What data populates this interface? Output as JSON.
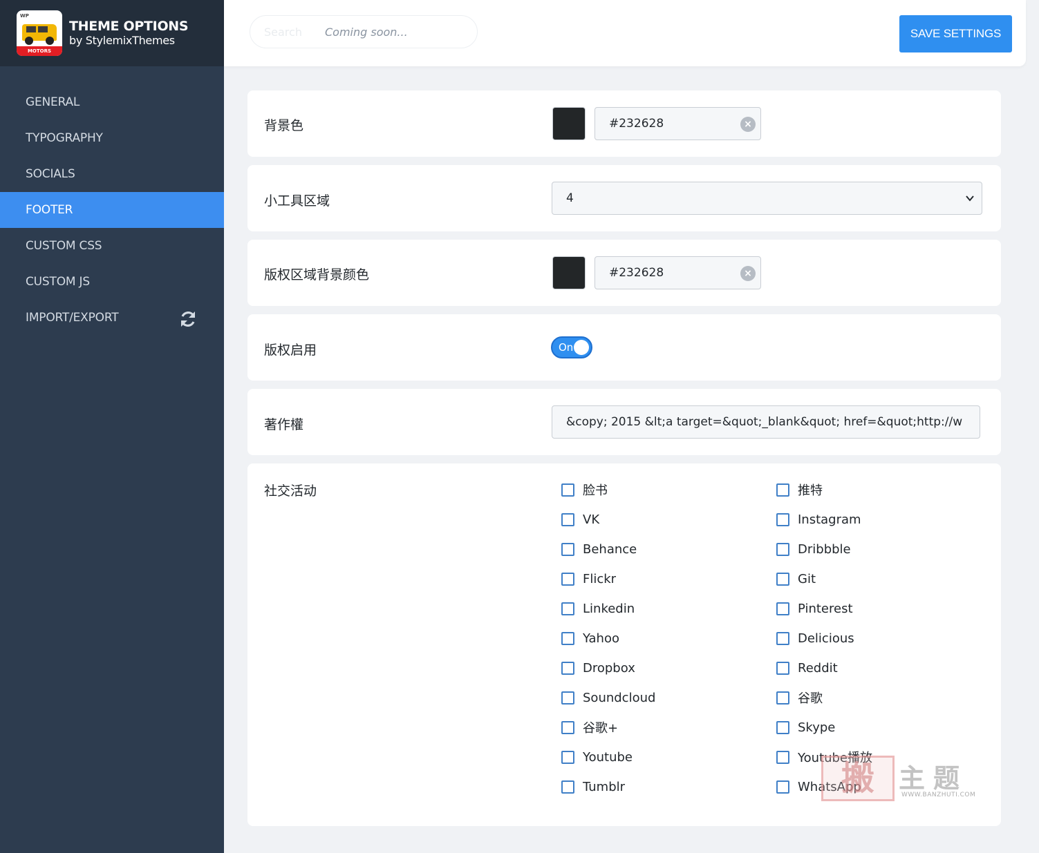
{
  "brand": {
    "title": "THEME OPTIONS",
    "subtitle": "by StylemixThemes",
    "logo_top": "WP",
    "logo_ribbon": "MOTORS"
  },
  "nav": {
    "items": [
      {
        "label": "GENERAL"
      },
      {
        "label": "TYPOGRAPHY"
      },
      {
        "label": "SOCIALS"
      },
      {
        "label": "FOOTER"
      },
      {
        "label": "CUSTOM CSS"
      },
      {
        "label": "CUSTOM JS"
      },
      {
        "label": "IMPORT/EXPORT",
        "icon": "refresh-icon"
      }
    ],
    "active": "FOOTER"
  },
  "header": {
    "search_placeholder": "Search",
    "search_note": "Coming soon...",
    "save_label": "SAVE SETTINGS"
  },
  "fields": {
    "bg_color": {
      "label": "背景色",
      "value": "#232628",
      "swatch": "#232628"
    },
    "widget_area": {
      "label": "小工具区域",
      "value": "4"
    },
    "copyright_bg": {
      "label": "版权区域背景颜色",
      "value": "#232628",
      "swatch": "#232628"
    },
    "copyright_enable": {
      "label": "版权启用",
      "toggle_text": "On",
      "enabled": true
    },
    "copyright_text": {
      "label": "著作權",
      "value": "&copy; 2015 &lt;a target=&quot;_blank&quot; href=&quot;http://w"
    },
    "socials": {
      "label": "社交活动",
      "options": [
        {
          "label": "脸书",
          "checked": false
        },
        {
          "label": "推特",
          "checked": false
        },
        {
          "label": "VK",
          "checked": false
        },
        {
          "label": "Instagram",
          "checked": false
        },
        {
          "label": "Behance",
          "checked": false
        },
        {
          "label": "Dribbble",
          "checked": false
        },
        {
          "label": "Flickr",
          "checked": false
        },
        {
          "label": "Git",
          "checked": false
        },
        {
          "label": "Linkedin",
          "checked": false
        },
        {
          "label": "Pinterest",
          "checked": false
        },
        {
          "label": "Yahoo",
          "checked": false
        },
        {
          "label": "Delicious",
          "checked": false
        },
        {
          "label": "Dropbox",
          "checked": false
        },
        {
          "label": "Reddit",
          "checked": false
        },
        {
          "label": "Soundcloud",
          "checked": false
        },
        {
          "label": "谷歌",
          "checked": false
        },
        {
          "label": "谷歌+",
          "checked": false
        },
        {
          "label": "Skype",
          "checked": false
        },
        {
          "label": "Youtube",
          "checked": false
        },
        {
          "label": "Youtube播放",
          "checked": false
        },
        {
          "label": "Tumblr",
          "checked": false
        },
        {
          "label": "WhatsApp",
          "checked": false
        }
      ]
    }
  },
  "watermark": {
    "glyph": "搬",
    "text": "主题",
    "url": "WWW.BANZHUTI.COM"
  },
  "colors": {
    "accent": "#3d8ef0",
    "sidebar": "#2d3c4f",
    "sidebar_header": "#232e3b",
    "background": "#f0f2f5"
  }
}
